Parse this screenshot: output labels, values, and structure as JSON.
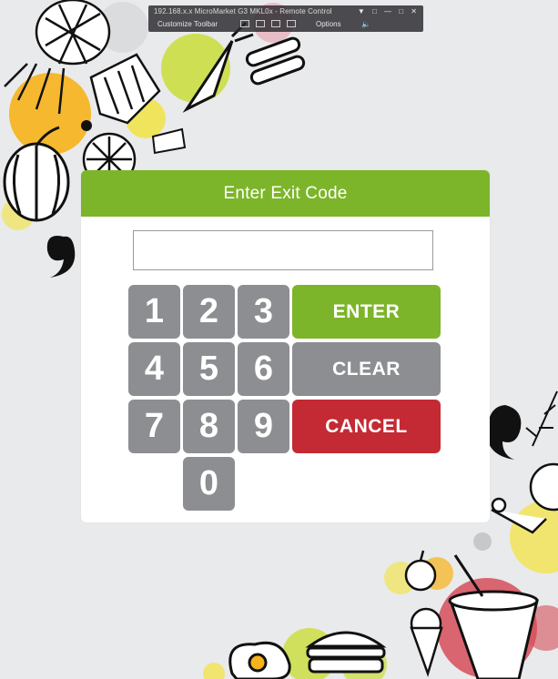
{
  "remote_toolbar": {
    "title": "192.168.x.x MicroMarket G3 MKL0x - Remote Control",
    "customize_label": "Customize Toolbar",
    "options_label": "Options"
  },
  "dialog": {
    "title": "Enter Exit Code",
    "code_value": "",
    "code_placeholder": ""
  },
  "keypad": {
    "keys": [
      "1",
      "2",
      "3",
      "4",
      "5",
      "6",
      "7",
      "8",
      "9",
      "0"
    ]
  },
  "actions": {
    "enter_label": "ENTER",
    "clear_label": "CLEAR",
    "cancel_label": "CANCEL"
  },
  "colors": {
    "header_green": "#7cb52a",
    "enter_green": "#7cb52a",
    "clear_gray": "#8d8e91",
    "cancel_red": "#c42a33",
    "key_gray": "#8d8e91"
  }
}
